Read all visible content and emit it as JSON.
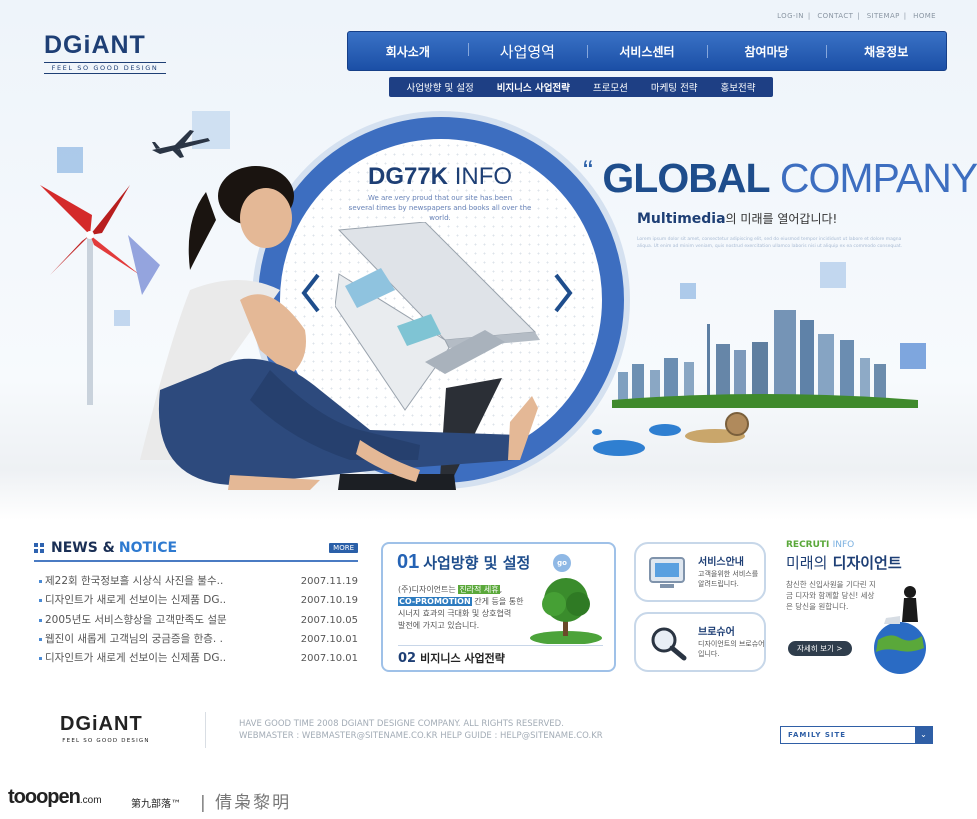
{
  "header": {
    "util_links": [
      "LOG-IN",
      "CONTACT",
      "SITEMAP",
      "HOME"
    ],
    "logo_main": "DGiANT",
    "logo_sub": "FEEL SO GOOD DESIGN",
    "nav": [
      "회사소개",
      "사업영역",
      "서비스센터",
      "참여마당",
      "채용정보"
    ],
    "subnav": [
      "사업방향 및 설정",
      "비지니스 사업전략",
      "프로모션",
      "마케팅 전략",
      "홍보전략"
    ]
  },
  "hero": {
    "dg77k_bold": "DG77K",
    "dg77k_thin": "INFO",
    "dg77k_desc_1": "We are very proud that our site has been",
    "dg77k_desc_2": "several times by newspapers and books all over the world.",
    "global_open": "“",
    "global_bold": "GLOBAL",
    "global_thin": "COMPANY",
    "global_close": "”",
    "sub_bold": "Multimedia",
    "sub_rest": "의 미래를 열어갑니다!",
    "desc": "Lorem ipsum dolor sit amet, consectetur adipiscing elit, sed do eiusmod tempor incididunt ut labore et dolore magna aliqua. Ut enim ad minim veniam, quis nostrud exercitation ullamco laboris nisi ut aliquip ex ea commodo consequat."
  },
  "news": {
    "title_1": "NEWS &",
    "title_2": "NOTICE",
    "more": "MORE",
    "items": [
      {
        "title": "제22회 한국정보흘 시상식 사진을 불수..",
        "date": "2007.11.19"
      },
      {
        "title": "디자인트가 새로게 선보이는 신제품 DG..",
        "date": "2007.10.19"
      },
      {
        "title": "2005년도 서비스향상을 고객만족도 설문",
        "date": "2007.10.05"
      },
      {
        "title": "웹진이 새롭게 고객님의 궁금증을 한층. .",
        "date": "2007.10.01"
      },
      {
        "title": "디자인트가 새로게 선보이는 신제품 DG..",
        "date": "2007.10.01"
      }
    ]
  },
  "box01": {
    "num": "01",
    "title": "사업방향 및 설정",
    "go": "go",
    "line1_a": "(주)디자이언트는",
    "line1_hl": "진라적 세휴",
    "line1_b": ",",
    "line2_hl": "CO-PROMOTION",
    "line2_b": "간게 등을 통한",
    "line3": "시너지 효과의 극대화 및 상호협력",
    "line4": "발전에 가지고 있습니다.",
    "num2": "02",
    "title2": "비지니스 사업전략"
  },
  "services": [
    {
      "title": "서비스안내",
      "text": "고객을위한 서비스를 알려드립니다."
    },
    {
      "title": "브로슈어",
      "text": "디자이언트의 브로슈어입니다."
    }
  ],
  "recruit": {
    "label_a": "RECRUTI",
    "label_b": "INFO",
    "title_a": "미래의",
    "title_b": "디자이언트",
    "text": "참신한 신입사원을 기다린 지금 디자와 함께할 당신! 세상은 당신을 원합니다.",
    "button": "자세히 보기 >"
  },
  "footer": {
    "logo_main": "DGiANT",
    "logo_sub": "FEEL SO GOOD DESIGN",
    "line1": "HAVE GOOD TIME 2008 DGIANT DESIGNE COMPANY. ALL RIGHTS RESERVED.",
    "line2": "WEBMASTER : WEBMASTER@SITENAME.CO.KR HELP GUIDE : HELP@SITENAME.CO.KR",
    "family": "FAMILY SITE"
  },
  "watermark": {
    "brand": "tooopen",
    "brand_suffix": ".com",
    "cn": "第九部落™",
    "cn2": "| 倩枭黎明"
  },
  "colors": {
    "brand_blue": "#1e3f75",
    "nav_blue": "#2a5fb5",
    "accent_green": "#5aa83a"
  }
}
